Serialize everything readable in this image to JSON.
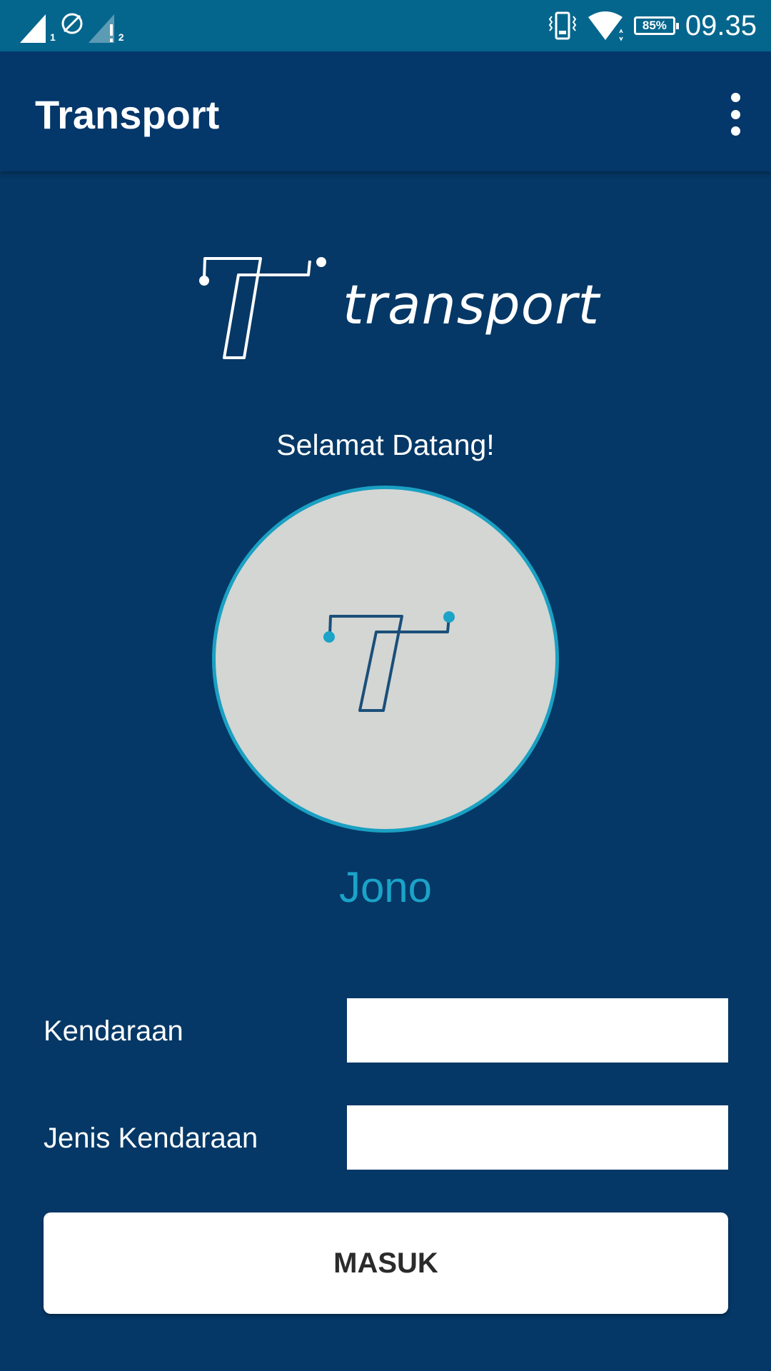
{
  "status_bar": {
    "sim1": "1",
    "sim2": "2",
    "battery": "85%",
    "time": "09.35"
  },
  "app_bar": {
    "title": "Transport",
    "menu_icon": "more-vert-icon"
  },
  "logo": {
    "text": "transport"
  },
  "welcome": "Selamat Datang!",
  "user": {
    "name": "Jono"
  },
  "form": {
    "vehicle_label": "Kendaraan",
    "vehicle_value": "",
    "vehicle_type_label": "Jenis Kendaraan",
    "vehicle_type_value": "",
    "submit_label": "MASUK"
  },
  "colors": {
    "status_bar": "#05668d",
    "app_bar": "#04376a",
    "background": "#053866",
    "accent": "#1ba3c8",
    "avatar_bg": "#d3d6d3"
  }
}
